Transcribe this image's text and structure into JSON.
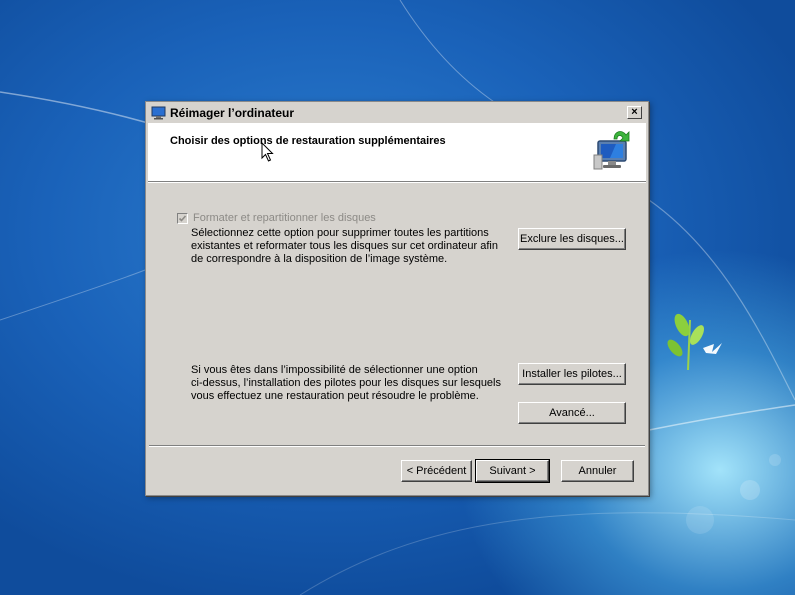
{
  "window": {
    "title": "Réimager l’ordinateur",
    "close_label": "×",
    "app_icon": "monitor-restore-icon"
  },
  "header": {
    "title": "Choisir des options de restauration supplémentaires",
    "icon": "computer-restore-icon"
  },
  "options": {
    "format_checkbox_label": "Formater et repartitionner les disques",
    "format_checked": true,
    "format_enabled": false,
    "format_description_lines": [
      "Sélectionnez cette option pour supprimer toutes les partitions",
      "existantes et reformater tous les disques sur cet ordinateur afin",
      "de correspondre à la disposition de l’image système."
    ],
    "exclude_button": "Exclure les disques...",
    "drivers_description_lines": [
      "Si vous êtes dans l’impossibilité de sélectionner une option",
      "ci-dessus, l’installation des pilotes pour les disques sur lesquels",
      "vous effectuez une restauration peut résoudre le problème."
    ],
    "install_drivers_button": "Installer les pilotes...",
    "advanced_button": "Avancé..."
  },
  "footer": {
    "back_button": "< Précédent",
    "next_button": "Suivant >",
    "cancel_button": "Annuler"
  },
  "colors": {
    "dialog_bg": "#d6d3ce",
    "desktop_blue": "#1a62b9",
    "disabled_text": "#8c8a86"
  }
}
